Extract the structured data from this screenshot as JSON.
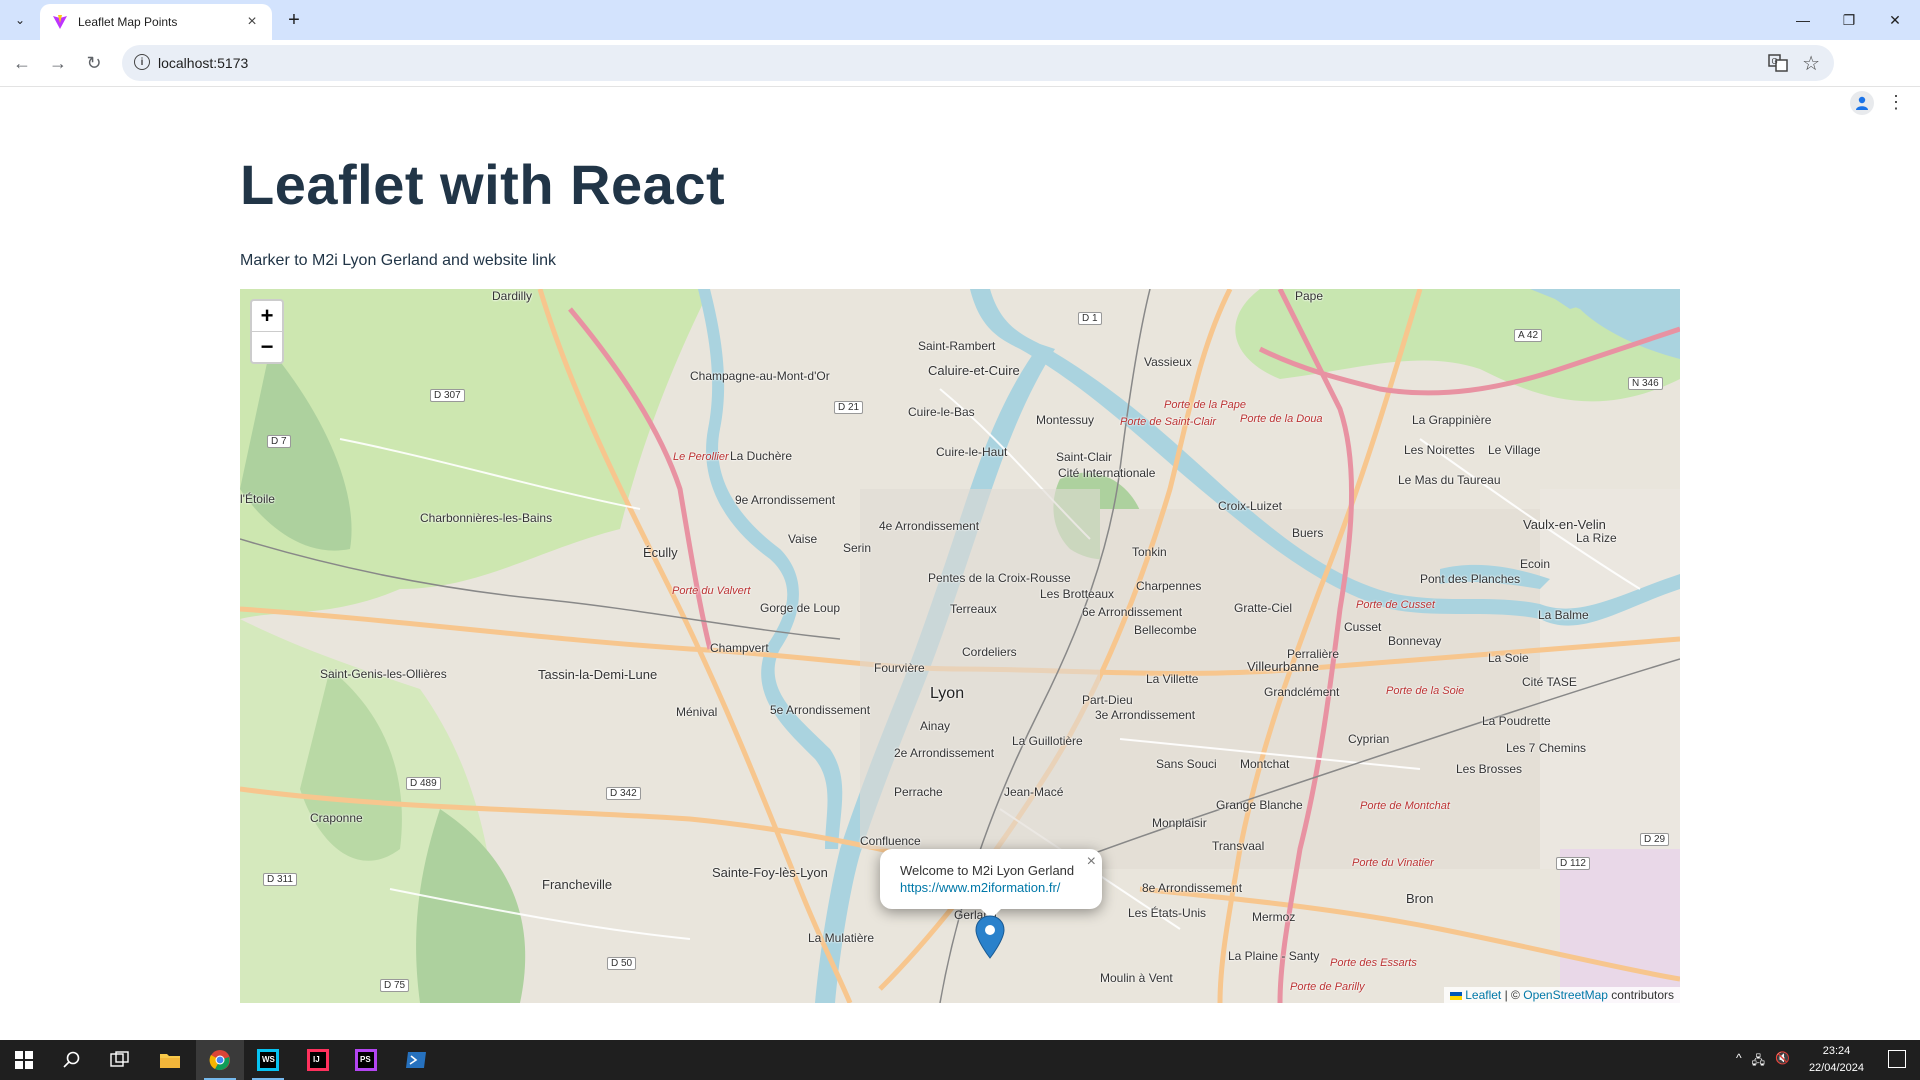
{
  "browser": {
    "tab_title": "Leaflet Map Points",
    "url": "localhost:5173"
  },
  "page": {
    "title": "Leaflet with React",
    "subtitle": "Marker to M2i Lyon Gerland and website link"
  },
  "map": {
    "zoom_in": "+",
    "zoom_out": "−",
    "popup": {
      "message": "Welcome to M2i Lyon Gerland",
      "link": "https://www.m2iformation.fr/",
      "close": "×"
    },
    "attribution": {
      "leaflet": "Leaflet",
      "separator": "| ©",
      "osm": "OpenStreetMap",
      "suffix": "contributors"
    },
    "labels": [
      {
        "text": "Lyon",
        "cls": "big"
      },
      {
        "text": "Villeurbanne",
        "cls": "mid"
      },
      {
        "text": "Caluire-et-Cuire",
        "cls": "mid"
      },
      {
        "text": "Vaulx-en-Velin",
        "cls": "mid"
      },
      {
        "text": "Bron",
        "cls": "mid"
      },
      {
        "text": "Écully",
        "cls": "mid"
      },
      {
        "text": "Tassin-la-Demi-Lune",
        "cls": "mid"
      },
      {
        "text": "Francheville",
        "cls": "mid"
      },
      {
        "text": "Sainte-Foy-lès-Lyon",
        "cls": "mid"
      },
      {
        "text": "La Mulatière",
        "cls": ""
      },
      {
        "text": "Saint-Rambert",
        "cls": ""
      },
      {
        "text": "Champagne-au-Mont-d'Or",
        "cls": ""
      },
      {
        "text": "La Duchère",
        "cls": ""
      },
      {
        "text": "9e Arrondissement",
        "cls": ""
      },
      {
        "text": "4e Arrondissement",
        "cls": ""
      },
      {
        "text": "5e Arrondissement",
        "cls": ""
      },
      {
        "text": "2e Arrondissement",
        "cls": ""
      },
      {
        "text": "3e Arrondissement",
        "cls": ""
      },
      {
        "text": "6e Arrondissement",
        "cls": ""
      },
      {
        "text": "8e Arrondissement",
        "cls": ""
      },
      {
        "text": "Cuire-le-Bas",
        "cls": ""
      },
      {
        "text": "Cuire-le-Haut",
        "cls": ""
      },
      {
        "text": "Montessuy",
        "cls": ""
      },
      {
        "text": "Saint-Clair",
        "cls": ""
      },
      {
        "text": "Cité Internationale",
        "cls": ""
      },
      {
        "text": "Vassieux",
        "cls": ""
      },
      {
        "text": "Croix-Luizet",
        "cls": ""
      },
      {
        "text": "Buers",
        "cls": ""
      },
      {
        "text": "Tonkin",
        "cls": ""
      },
      {
        "text": "Charpennes",
        "cls": ""
      },
      {
        "text": "Les Brotteaux",
        "cls": ""
      },
      {
        "text": "Bellecombe",
        "cls": ""
      },
      {
        "text": "La Villette",
        "cls": ""
      },
      {
        "text": "Part-Dieu",
        "cls": ""
      },
      {
        "text": "Gratte-Ciel",
        "cls": ""
      },
      {
        "text": "Perralière",
        "cls": ""
      },
      {
        "text": "Cusset",
        "cls": ""
      },
      {
        "text": "Bonnevay",
        "cls": ""
      },
      {
        "text": "Grandclément",
        "cls": ""
      },
      {
        "text": "Cyprian",
        "cls": ""
      },
      {
        "text": "Montchat",
        "cls": ""
      },
      {
        "text": "Sans Souci",
        "cls": ""
      },
      {
        "text": "Grange Blanche",
        "cls": ""
      },
      {
        "text": "Monplaisir",
        "cls": ""
      },
      {
        "text": "Transvaal",
        "cls": ""
      },
      {
        "text": "Les États-Unis",
        "cls": ""
      },
      {
        "text": "Mermoz",
        "cls": ""
      },
      {
        "text": "La Plaine - Santy",
        "cls": ""
      },
      {
        "text": "Moulin à Vent",
        "cls": ""
      },
      {
        "text": "Gerland",
        "cls": ""
      },
      {
        "text": "Confluence",
        "cls": ""
      },
      {
        "text": "Perrache",
        "cls": ""
      },
      {
        "text": "Jean-Macé",
        "cls": ""
      },
      {
        "text": "La Guillotière",
        "cls": ""
      },
      {
        "text": "Ainay",
        "cls": ""
      },
      {
        "text": "Cordeliers",
        "cls": ""
      },
      {
        "text": "Terreaux",
        "cls": ""
      },
      {
        "text": "Pentes de la Croix-Rousse",
        "cls": ""
      },
      {
        "text": "Fourvière",
        "cls": ""
      },
      {
        "text": "Champvert",
        "cls": ""
      },
      {
        "text": "Gorge de Loup",
        "cls": ""
      },
      {
        "text": "Vaise",
        "cls": ""
      },
      {
        "text": "Serin",
        "cls": ""
      },
      {
        "text": "Ménival",
        "cls": ""
      },
      {
        "text": "Saint-Genis-les-Ollières",
        "cls": ""
      },
      {
        "text": "Craponne",
        "cls": ""
      },
      {
        "text": "Charbonnières-les-Bains",
        "cls": ""
      },
      {
        "text": "l'Étoile",
        "cls": ""
      },
      {
        "text": "Dardilly",
        "cls": ""
      },
      {
        "text": "Pape",
        "cls": ""
      },
      {
        "text": "La Grappinière",
        "cls": ""
      },
      {
        "text": "Les Noirettes",
        "cls": ""
      },
      {
        "text": "Le Village",
        "cls": ""
      },
      {
        "text": "Le Mas du Taureau",
        "cls": ""
      },
      {
        "text": "La Rize",
        "cls": ""
      },
      {
        "text": "Ecoin",
        "cls": ""
      },
      {
        "text": "Pont des Planches",
        "cls": ""
      },
      {
        "text": "La Balme",
        "cls": ""
      },
      {
        "text": "La Soie",
        "cls": ""
      },
      {
        "text": "Cité TASE",
        "cls": ""
      },
      {
        "text": "La Poudrette",
        "cls": ""
      },
      {
        "text": "Les 7 Chemins",
        "cls": ""
      },
      {
        "text": "Les Brosses",
        "cls": ""
      },
      {
        "text": "Porte de la Pape",
        "cls": "red"
      },
      {
        "text": "Porte de Saint-Clair",
        "cls": "red"
      },
      {
        "text": "Porte de la Doua",
        "cls": "red"
      },
      {
        "text": "Porte de Cusset",
        "cls": "red"
      },
      {
        "text": "Porte de la Soie",
        "cls": "red"
      },
      {
        "text": "Porte de Montchat",
        "cls": "red"
      },
      {
        "text": "Porte du Vinatier",
        "cls": "red"
      },
      {
        "text": "Porte des Essarts",
        "cls": "red"
      },
      {
        "text": "Porte de Parilly",
        "cls": "red"
      },
      {
        "text": "Porte du Valvert",
        "cls": "red"
      },
      {
        "text": "Le Perollier",
        "cls": "red"
      }
    ],
    "shields": [
      "D 307",
      "D 7",
      "D 21",
      "D 1",
      "A 42",
      "N 346",
      "D 489",
      "D 342",
      "D 311",
      "D 50",
      "D 75",
      "D 112",
      "D 29"
    ]
  },
  "taskbar": {
    "time": "23:24",
    "date": "22/04/2024"
  }
}
